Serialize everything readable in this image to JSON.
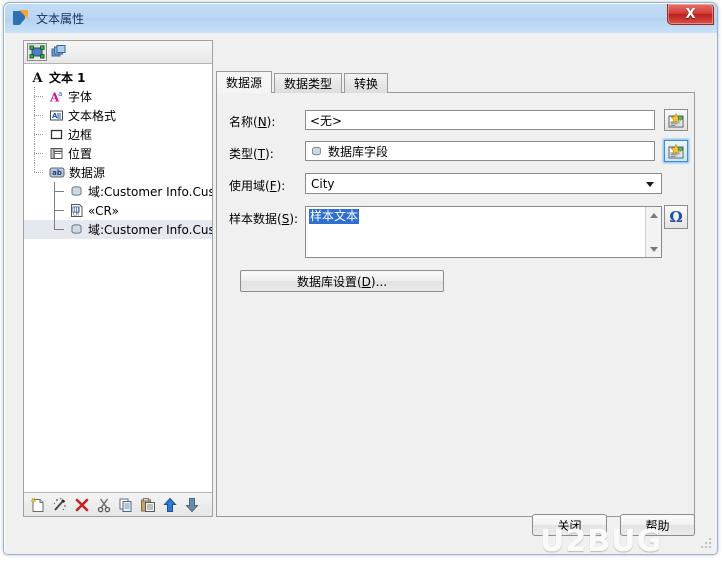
{
  "window": {
    "title": "文本属性",
    "app_icon": "document-blue-orange-icon",
    "close_label": "X"
  },
  "tree_toolbar": {
    "buttons": [
      {
        "name": "select-object-button",
        "icon": "selection-box-icon",
        "pressed": true
      },
      {
        "name": "layers-button",
        "icon": "layers-stack-icon",
        "pressed": false
      }
    ]
  },
  "tree": {
    "root": {
      "label": "文本 1",
      "icon": "letter-a-icon"
    },
    "children": [
      {
        "label": "字体",
        "icon": "font-a-icon"
      },
      {
        "label": "文本格式",
        "icon": "text-format-icon"
      },
      {
        "label": "边框",
        "icon": "border-square-icon"
      },
      {
        "label": "位置",
        "icon": "position-ruler-icon"
      },
      {
        "label": "数据源",
        "icon": "datasource-ab-icon"
      }
    ],
    "datasource_children": [
      {
        "label": "域:Customer Info.Cus",
        "icon": "database-field-icon",
        "selected": false
      },
      {
        "label": "«CR»",
        "icon": "carriage-return-icon",
        "selected": false
      },
      {
        "label": "域:Customer Info.Cus",
        "icon": "database-field-icon",
        "selected": true
      }
    ]
  },
  "tree_footer": {
    "buttons": [
      {
        "name": "new-button",
        "icon": "new-document-icon"
      },
      {
        "name": "wizard-button",
        "icon": "magic-wand-icon"
      },
      {
        "name": "delete-button",
        "icon": "red-x-icon"
      },
      {
        "name": "cut-button",
        "icon": "scissors-icon"
      },
      {
        "name": "copy-button",
        "icon": "copy-icon"
      },
      {
        "name": "paste-button",
        "icon": "paste-icon"
      },
      {
        "name": "move-up-button",
        "icon": "arrow-up-icon"
      },
      {
        "name": "move-down-button",
        "icon": "arrow-down-icon"
      }
    ]
  },
  "tabs": [
    {
      "label": "数据源",
      "active": true
    },
    {
      "label": "数据类型",
      "active": false
    },
    {
      "label": "转换",
      "active": false
    }
  ],
  "form": {
    "name_label": "名称",
    "name_accel": "N",
    "name_value": "<无>",
    "type_label": "类型",
    "type_accel": "T",
    "type_value": "数据库字段",
    "type_icon": "database-icon",
    "field_label": "使用域",
    "field_accel": "F",
    "field_value": "City",
    "sample_label": "样本数据",
    "sample_accel": "S",
    "sample_value": "样本文本",
    "db_settings_label": "数据库设置",
    "db_settings_accel": "D",
    "db_settings_suffix": "...",
    "picker_icon": "picker-image-icon",
    "omega_label": "Ω"
  },
  "buttons": {
    "close": "关闭",
    "help": "帮助"
  },
  "watermark": "U2BUG",
  "colors": {
    "titlebar": "#bbd7f3",
    "close_red": "#bb1f18",
    "selection_blue": "#2f6fd0",
    "dialog_bg": "#f0f0f0",
    "accent_blue": "#1e4fa0"
  }
}
